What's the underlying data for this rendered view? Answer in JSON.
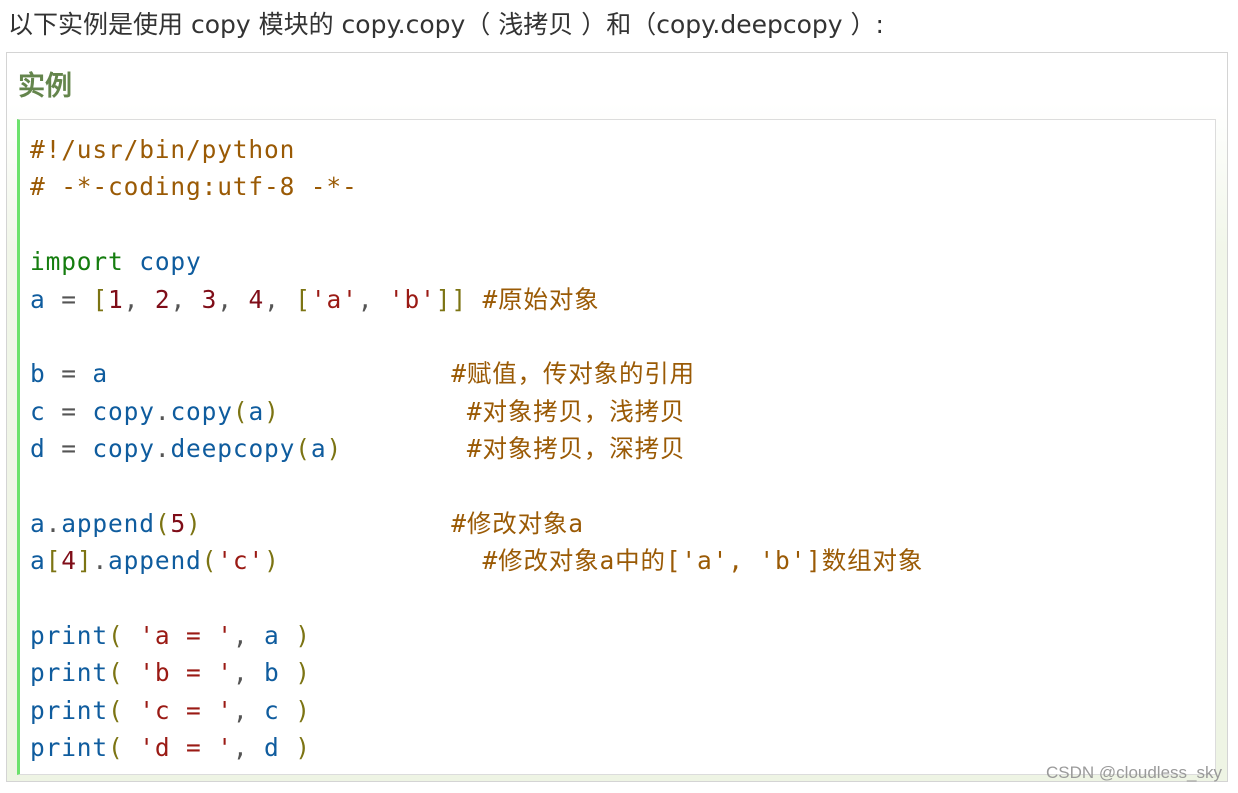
{
  "intro_text": "以下实例是使用 copy 模块的 copy.copy（ 浅拷贝 ）和（copy.deepcopy ）:",
  "example_title": "实例",
  "code": {
    "lines": [
      [
        {
          "t": "#!/usr/bin/python",
          "c": "comment"
        }
      ],
      [
        {
          "t": "# -*-coding:utf-8 -*-",
          "c": "comment"
        }
      ],
      [],
      [
        {
          "t": "import",
          "c": "kw"
        },
        {
          "t": " ",
          "c": "p"
        },
        {
          "t": "copy",
          "c": "name"
        }
      ],
      [
        {
          "t": "a",
          "c": "name"
        },
        {
          "t": " = ",
          "c": "op"
        },
        {
          "t": "[",
          "c": "br"
        },
        {
          "t": "1",
          "c": "num"
        },
        {
          "t": ", ",
          "c": "p"
        },
        {
          "t": "2",
          "c": "num"
        },
        {
          "t": ", ",
          "c": "p"
        },
        {
          "t": "3",
          "c": "num"
        },
        {
          "t": ", ",
          "c": "p"
        },
        {
          "t": "4",
          "c": "num"
        },
        {
          "t": ", ",
          "c": "p"
        },
        {
          "t": "[",
          "c": "br"
        },
        {
          "t": "'a'",
          "c": "str"
        },
        {
          "t": ", ",
          "c": "p"
        },
        {
          "t": "'b'",
          "c": "str"
        },
        {
          "t": "]]",
          "c": "br"
        },
        {
          "t": " ",
          "c": "p"
        },
        {
          "t": "#原始对象",
          "c": "comment"
        }
      ],
      [],
      [
        {
          "t": "b",
          "c": "name"
        },
        {
          "t": " = ",
          "c": "op"
        },
        {
          "t": "a",
          "c": "name"
        },
        {
          "t": "                      ",
          "c": "p"
        },
        {
          "t": "#赋值，传对象的引用",
          "c": "comment"
        }
      ],
      [
        {
          "t": "c",
          "c": "name"
        },
        {
          "t": " = ",
          "c": "op"
        },
        {
          "t": "copy",
          "c": "name"
        },
        {
          "t": ".",
          "c": "p"
        },
        {
          "t": "copy",
          "c": "name"
        },
        {
          "t": "(",
          "c": "br"
        },
        {
          "t": "a",
          "c": "name"
        },
        {
          "t": ")",
          "c": "br"
        },
        {
          "t": "            ",
          "c": "p"
        },
        {
          "t": "#对象拷贝，浅拷贝",
          "c": "comment"
        }
      ],
      [
        {
          "t": "d",
          "c": "name"
        },
        {
          "t": " = ",
          "c": "op"
        },
        {
          "t": "copy",
          "c": "name"
        },
        {
          "t": ".",
          "c": "p"
        },
        {
          "t": "deepcopy",
          "c": "name"
        },
        {
          "t": "(",
          "c": "br"
        },
        {
          "t": "a",
          "c": "name"
        },
        {
          "t": ")",
          "c": "br"
        },
        {
          "t": "        ",
          "c": "p"
        },
        {
          "t": "#对象拷贝，深拷贝",
          "c": "comment"
        }
      ],
      [],
      [
        {
          "t": "a",
          "c": "name"
        },
        {
          "t": ".",
          "c": "p"
        },
        {
          "t": "append",
          "c": "name"
        },
        {
          "t": "(",
          "c": "br"
        },
        {
          "t": "5",
          "c": "num"
        },
        {
          "t": ")",
          "c": "br"
        },
        {
          "t": "                ",
          "c": "p"
        },
        {
          "t": "#修改对象a",
          "c": "comment"
        }
      ],
      [
        {
          "t": "a",
          "c": "name"
        },
        {
          "t": "[",
          "c": "br"
        },
        {
          "t": "4",
          "c": "num"
        },
        {
          "t": "]",
          "c": "br"
        },
        {
          "t": ".",
          "c": "p"
        },
        {
          "t": "append",
          "c": "name"
        },
        {
          "t": "(",
          "c": "br"
        },
        {
          "t": "'c'",
          "c": "str"
        },
        {
          "t": ")",
          "c": "br"
        },
        {
          "t": "             ",
          "c": "p"
        },
        {
          "t": "#修改对象a中的['a', 'b']数组对象",
          "c": "comment"
        }
      ],
      [],
      [
        {
          "t": "print",
          "c": "name"
        },
        {
          "t": "(",
          "c": "br"
        },
        {
          "t": " ",
          "c": "p"
        },
        {
          "t": "'a = '",
          "c": "str"
        },
        {
          "t": ", ",
          "c": "p"
        },
        {
          "t": "a",
          "c": "name"
        },
        {
          "t": " ",
          "c": "p"
        },
        {
          "t": ")",
          "c": "br"
        }
      ],
      [
        {
          "t": "print",
          "c": "name"
        },
        {
          "t": "(",
          "c": "br"
        },
        {
          "t": " ",
          "c": "p"
        },
        {
          "t": "'b = '",
          "c": "str"
        },
        {
          "t": ", ",
          "c": "p"
        },
        {
          "t": "b",
          "c": "name"
        },
        {
          "t": " ",
          "c": "p"
        },
        {
          "t": ")",
          "c": "br"
        }
      ],
      [
        {
          "t": "print",
          "c": "name"
        },
        {
          "t": "(",
          "c": "br"
        },
        {
          "t": " ",
          "c": "p"
        },
        {
          "t": "'c = '",
          "c": "str"
        },
        {
          "t": ", ",
          "c": "p"
        },
        {
          "t": "c",
          "c": "name"
        },
        {
          "t": " ",
          "c": "p"
        },
        {
          "t": ")",
          "c": "br"
        }
      ],
      [
        {
          "t": "print",
          "c": "name"
        },
        {
          "t": "(",
          "c": "br"
        },
        {
          "t": " ",
          "c": "p"
        },
        {
          "t": "'d = '",
          "c": "str"
        },
        {
          "t": ", ",
          "c": "p"
        },
        {
          "t": "d",
          "c": "name"
        },
        {
          "t": " ",
          "c": "p"
        },
        {
          "t": ")",
          "c": "br"
        }
      ]
    ]
  },
  "watermark": "CSDN @cloudless_sky",
  "colors": {
    "title_green": "#64854c",
    "comment": "#9a5a05",
    "keyword": "#157d0f",
    "identifier": "#0f5c9e",
    "number": "#7f0d18",
    "string": "#9a1a14",
    "bracket": "#7c7413"
  }
}
